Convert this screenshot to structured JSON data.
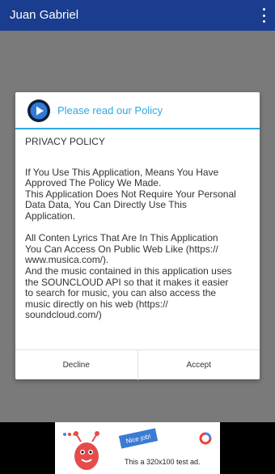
{
  "appbar": {
    "title": "Juan Gabriel",
    "overflow_icon": "overflow-menu-icon"
  },
  "dialog": {
    "icon": "play-button-icon",
    "title": "Please read our Policy",
    "heading": "PRIVACY POLICY",
    "paragraph1": "If You Use This Application, Means You Have\nApproved The Policy We Made.\nThis Application Does Not Require Your Personal\nData Data, You Can Directly Use This\nApplication.",
    "paragraph2": "All Conten Lyrics That Are In This Application\nYou Can Access On Public Web Like (https://\nwww.musica.com/).\nAnd the music contained in this application uses\nthe SOUNCLOUD API so that it makes it easier\nto search for music, you can also access the\nmusic directly on his web (https://\nsoundcloud.com/)",
    "decline_label": "Decline",
    "accept_label": "Accept"
  },
  "ad": {
    "banner_text": "Nice job!",
    "text": "This a 320x100 test ad."
  },
  "colors": {
    "appbar": "#1a3d8f",
    "accent": "#2ea8e0"
  }
}
